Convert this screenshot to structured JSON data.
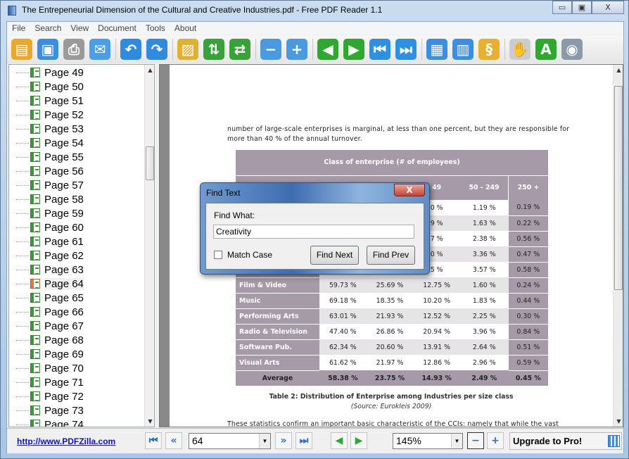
{
  "window": {
    "title": "The Entrepeneurial Dimension of the Cultural and Creative Industries.pdf - Free PDF Reader 1.1",
    "minimize": "▭",
    "maximize": "▣",
    "close": "X"
  },
  "menu": [
    "File",
    "Search",
    "View",
    "Document",
    "Tools",
    "About"
  ],
  "toolbar": [
    {
      "icon": "open-icon",
      "glyph": "▤",
      "color": "#e9a92a"
    },
    {
      "icon": "save-icon",
      "glyph": "▣",
      "color": "#3a8fe0"
    },
    {
      "icon": "print-icon",
      "glyph": "⎙",
      "color": "#9a9a9a"
    },
    {
      "icon": "email-icon",
      "glyph": "✉",
      "color": "#4aa0e8"
    },
    {
      "sep": true
    },
    {
      "icon": "undo-icon",
      "glyph": "↶",
      "color": "#2f8ae0"
    },
    {
      "icon": "redo-icon",
      "glyph": "↷",
      "color": "#2f8ae0"
    },
    {
      "sep": true
    },
    {
      "icon": "image-icon",
      "glyph": "▨",
      "color": "#e0b030"
    },
    {
      "icon": "rotate-up-icon",
      "glyph": "⇅",
      "color": "#3aa03a"
    },
    {
      "icon": "rotate-icon",
      "glyph": "⇄",
      "color": "#3aa03a"
    },
    {
      "sep": true
    },
    {
      "icon": "zoom-out-icon",
      "glyph": "−",
      "color": "#4a9ae0"
    },
    {
      "icon": "zoom-in-icon",
      "glyph": "+",
      "color": "#4a9ae0"
    },
    {
      "sep": true
    },
    {
      "icon": "previous-page-icon",
      "glyph": "◀",
      "color": "#2ea82e"
    },
    {
      "icon": "next-page-icon",
      "glyph": "▶",
      "color": "#2ea82e"
    },
    {
      "icon": "first-page-icon",
      "glyph": "⏮",
      "color": "#2f8fe0"
    },
    {
      "icon": "last-page-icon",
      "glyph": "⏭",
      "color": "#2f8fe0"
    },
    {
      "sep": true
    },
    {
      "icon": "single-page-icon",
      "glyph": "▦",
      "color": "#3a8fe0"
    },
    {
      "icon": "multi-page-icon",
      "glyph": "▥",
      "color": "#3a8fe0"
    },
    {
      "icon": "scroll-icon",
      "glyph": "§",
      "color": "#e8b030"
    },
    {
      "sep": true
    },
    {
      "icon": "hand-tool-icon",
      "glyph": "✋",
      "color": "#cccccc"
    },
    {
      "icon": "text-select-icon",
      "glyph": "A",
      "color": "#2ea82e"
    },
    {
      "icon": "snapshot-icon",
      "glyph": "◉",
      "color": "#8a9aa8"
    }
  ],
  "sidebar": {
    "items": [
      "Page 49",
      "Page 50",
      "Page 51",
      "Page 52",
      "Page 53",
      "Page 54",
      "Page 55",
      "Page 56",
      "Page 57",
      "Page 58",
      "Page 59",
      "Page 60",
      "Page 61",
      "Page 62",
      "Page 63",
      "Page 64",
      "Page 65",
      "Page 66",
      "Page 67",
      "Page 68",
      "Page 69",
      "Page 70",
      "Page 71",
      "Page 72",
      "Page 73",
      "Page 74"
    ],
    "selected": "Page 64"
  },
  "document": {
    "para1": "number of large-scale enterprises is marginal, at less than one percent, but they are responsible for",
    "para2": "more than 40 % of the annual turnover.",
    "table": {
      "group_header": "Class of enterprise (# of employees)",
      "columns": [
        "",
        "",
        "",
        "49",
        "50 - 249",
        "250 +"
      ],
      "hidden_rows": [
        [
          "",
          "",
          "",
          "0 %",
          "1.19 %",
          "0.19 %"
        ],
        [
          "",
          "",
          "",
          "9 %",
          "1.63 %",
          "0.22 %"
        ],
        [
          "",
          "",
          "",
          "7 %",
          "2.38 %",
          "0.56 %"
        ],
        [
          "",
          "",
          "",
          "0 %",
          "3.36 %",
          "0.47 %"
        ],
        [
          "",
          "",
          "",
          "5 %",
          "3.57 %",
          "0.58 %"
        ]
      ],
      "rows": [
        [
          "Film & Video",
          "59.73 %",
          "25.69 %",
          "12.75 %",
          "1.60 %",
          "0.24 %"
        ],
        [
          "Music",
          "69.18 %",
          "18.35 %",
          "10.20 %",
          "1.83 %",
          "0.44 %"
        ],
        [
          "Performing Arts",
          "63.01 %",
          "21.93 %",
          "12.52 %",
          "2.25 %",
          "0.30 %"
        ],
        [
          "Radio & Television",
          "47.40 %",
          "26.86 %",
          "20.94 %",
          "3.96 %",
          "0.84 %"
        ],
        [
          "Software Pub.",
          "62.34 %",
          "20.60 %",
          "13.91 %",
          "2.64 %",
          "0.51 %"
        ],
        [
          "Visual Arts",
          "61.62 %",
          "21.97 %",
          "12.86 %",
          "2.96 %",
          "0.59 %"
        ]
      ],
      "average": [
        "Average",
        "58.38 %",
        "23.75 %",
        "14.93 %",
        "2.49 %",
        "0.45 %"
      ]
    },
    "caption": "Table 2: Distribution of Enterprise among Industries per size class",
    "source": "(Source: Eurokleis 2009)",
    "para3": "These statistics confirm an important basic characteristic of the CCIs: namely that while the vast"
  },
  "bottom": {
    "link": "http://www.PDFZilla.com",
    "page": "64",
    "zoom": "145%",
    "upgrade": "Upgrade to Pro!"
  },
  "dialog": {
    "title": "Find Text",
    "close": "X",
    "find_what_label": "Find What:",
    "find_value": "Creativity",
    "match_case": "Match Case",
    "match_case_checked": false,
    "find_next": "Find Next",
    "find_prev": "Find Prev"
  }
}
